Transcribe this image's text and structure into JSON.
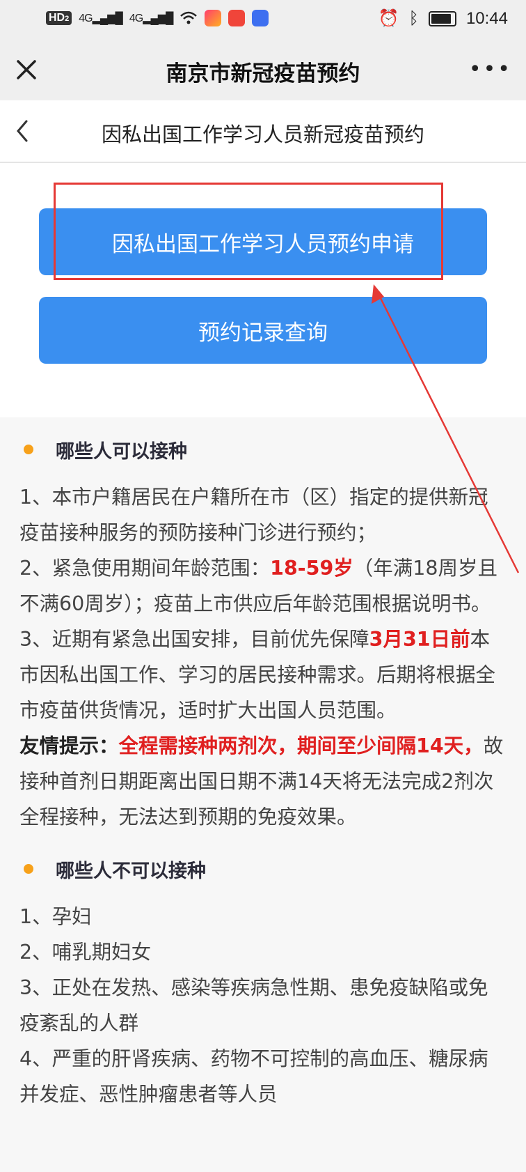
{
  "status_bar": {
    "hd": "HD",
    "hd_sub": "2",
    "sig1": "4G",
    "sig2": "4G",
    "time": "10:44"
  },
  "titlebar": {
    "title": "南京市新冠疫苗预约",
    "more": "•••"
  },
  "subbar": {
    "title": "因私出国工作学习人员新冠疫苗预约"
  },
  "buttons": {
    "apply": "因私出国工作学习人员预约申请",
    "query": "预约记录查询"
  },
  "section1": {
    "heading": "哪些人可以接种",
    "item1": "1、本市户籍居民在户籍所在市（区）指定的提供新冠疫苗接种服务的预防接种门诊进行预约；",
    "item2_a": "2、紧急使用期间年龄范围：",
    "item2_red": "18-59岁",
    "item2_b": "（年满18周岁且不满60周岁）；疫苗上市供应后年龄范围根据说明书。",
    "item3_a": "3、近期有紧急出国安排，目前优先保障",
    "item3_red": "3月31日前",
    "item3_b": "本市因私出国工作、学习的居民接种需求。后期将根据全市疫苗供货情况，适时扩大出国人员范围。",
    "tip_label": "友情提示：",
    "tip_red": "全程需接种两剂次，期间至少间隔14天，",
    "tip_rest": "故接种首剂日期距离出国日期不满14天将无法完成2剂次全程接种，无法达到预期的免疫效果。"
  },
  "section2": {
    "heading": "哪些人不可以接种",
    "items": [
      "1、孕妇",
      "2、哺乳期妇女",
      "3、正处在发热、感染等疾病急性期、患免疫缺陷或免疫紊乱的人群",
      "4、严重的肝肾疾病、药物不可控制的高血压、糖尿病并发症、恶性肿瘤患者等人员"
    ]
  },
  "colors": {
    "button": "#3a8ff0",
    "highlight": "#e02020",
    "dot": "#f7a11a",
    "annotation": "#e53935"
  }
}
